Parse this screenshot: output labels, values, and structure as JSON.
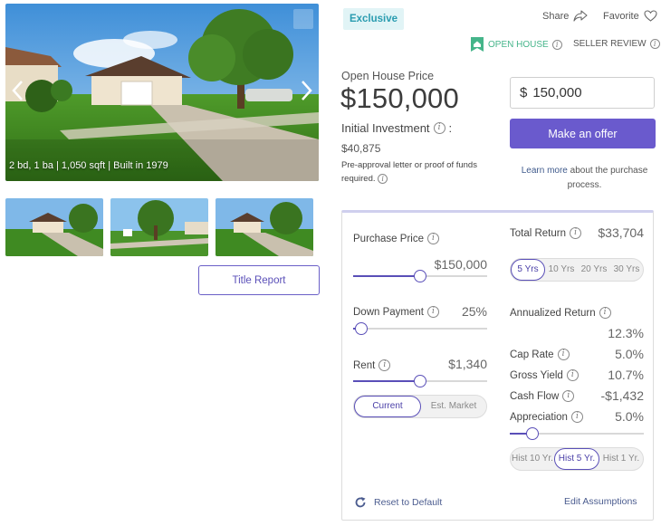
{
  "gallery": {
    "caption": "2 bd, 1 ba | 1,050 sqft | Built in 1979",
    "title_report_label": "Title Report"
  },
  "header": {
    "exclusive_badge": "Exclusive",
    "share_label": "Share",
    "favorite_label": "Favorite",
    "open_house_label": "OPEN HOUSE",
    "seller_review_label": "SELLER REVIEW"
  },
  "pricing": {
    "open_house_price_label": "Open House Price",
    "open_house_price": "$150,000",
    "initial_investment_label": "Initial Investment",
    "initial_investment_colon": ":",
    "initial_investment_value": "$40,875",
    "preapproval_note": "Pre-approval letter or proof of funds required."
  },
  "offer": {
    "currency_symbol": "$",
    "amount": "150,000",
    "button_label": "Make an offer",
    "learn_more_link": "Learn more",
    "learn_more_rest": " about the purchase process."
  },
  "calculator": {
    "purchase_price_label": "Purchase Price",
    "purchase_price_value": "$150,000",
    "purchase_price_slider": 0.5,
    "down_payment_label": "Down Payment",
    "down_payment_value": "25%",
    "down_payment_slider": 0.06,
    "rent_label": "Rent",
    "rent_value": "$1,340",
    "rent_slider": 0.5,
    "rent_modes": [
      "Current",
      "Est. Market"
    ],
    "rent_mode_selected": "Current",
    "total_return_label": "Total Return",
    "total_return_value": "$33,704",
    "periods": [
      "5 Yrs",
      "10 Yrs",
      "20 Yrs",
      "30 Yrs"
    ],
    "period_selected": "5 Yrs",
    "annualized_return_label": "Annualized Return",
    "annualized_return_value": "12.3%",
    "cap_rate_label": "Cap Rate",
    "cap_rate_value": "5.0%",
    "gross_yield_label": "Gross Yield",
    "gross_yield_value": "10.7%",
    "cash_flow_label": "Cash Flow",
    "cash_flow_value": "-$1,432",
    "appreciation_label": "Appreciation",
    "appreciation_value": "5.0%",
    "appreciation_slider": 0.17,
    "hist_options": [
      "Hist 10 Yr.",
      "Hist 5 Yr.",
      "Hist 1 Yr."
    ],
    "hist_selected": "Hist 5 Yr.",
    "reset_label": "Reset to Default",
    "edit_assumptions_label": "Edit Assumptions"
  },
  "colors": {
    "accent": "#6a5acd",
    "open_house_green": "#45b58a",
    "exclusive_bg": "#e1f4f6",
    "exclusive_text": "#2a9cb0"
  }
}
